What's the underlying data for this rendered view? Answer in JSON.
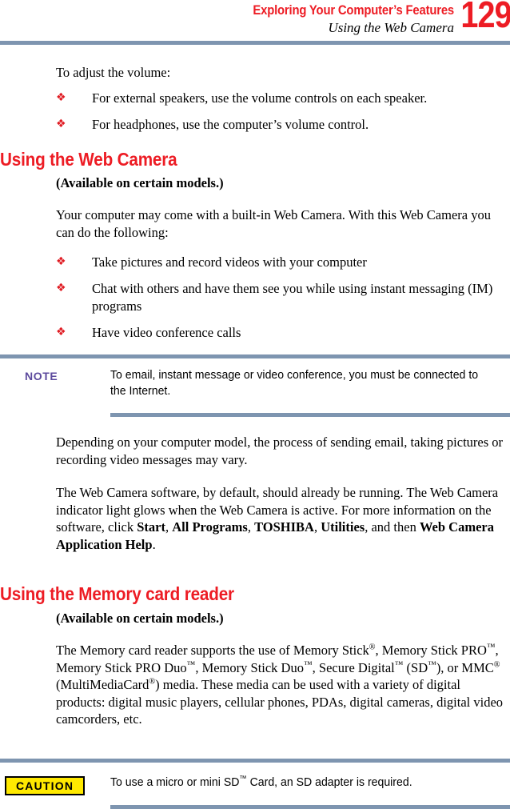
{
  "header": {
    "chapter": "Exploring Your Computer’s Features",
    "section": "Using the Web Camera",
    "page_number": "129",
    "chapter_color": "#ED1C24",
    "rule_color": "#7E95B0"
  },
  "intro": {
    "lead": "To adjust the volume:",
    "bullets": [
      "For external speakers, use the volume controls on each speaker.",
      "For headphones, use the computer’s volume control."
    ]
  },
  "webcam": {
    "heading": "Using the Web Camera",
    "availability": "(Available on certain models.)",
    "intro": "Your computer may come with a built-in Web Camera. With this Web Camera you can do the following:",
    "bullets": [
      "Take pictures and record videos with your computer",
      "Chat with others and have them see you while using instant messaging (IM) programs",
      "Have video conference calls"
    ],
    "note": {
      "label": "NOTE",
      "text": "To email, instant message or video conference, you must be connected to the Internet.",
      "label_color": "#5C4A9D"
    },
    "para_depending": "Depending on your computer model, the process of sending email, taking pictures or recording video messages may vary.",
    "para_software": {
      "part1": "The Web Camera software, by default, should already be running. The Web Camera indicator light glows when the Web Camera is active. For more information on the software, click ",
      "bold1": "Start",
      "sep1": ", ",
      "bold2": "All Programs",
      "sep2": ", ",
      "bold3": "TOSHIBA",
      "sep3": ", ",
      "bold4": "Utilities",
      "sep4": ", and then ",
      "bold5": "Web Camera Application Help",
      "end": "."
    }
  },
  "memcard": {
    "heading": "Using the Memory card reader",
    "availability": "(Available on certain models.)",
    "para_prefix": "The Memory card reader supports the use of Memory Stick",
    "para_mid1": ", Memory Stick PRO",
    "para_mid2": ", Memory Stick PRO Duo",
    "para_mid3": ", Memory Stick Duo",
    "para_mid4": ", Secure Digital",
    "para_mid5": " (SD",
    "para_mid6": "), or MMC",
    "para_mid7": " (MultiMediaCard",
    "para_tail": ") media. These media can be used with a variety of digital products: digital music players, cellular phones, PDAs, digital cameras, digital video camcorders, etc.",
    "sym_registered": "®",
    "sym_tm": "™",
    "caution": {
      "label": "CAUTION",
      "text_before": "To use a micro or mini SD",
      "text_after": " Card, an SD adapter is required.",
      "box_fill": "#FFE900",
      "box_border": "#000000"
    }
  },
  "icons": {
    "bullet": "❖"
  }
}
